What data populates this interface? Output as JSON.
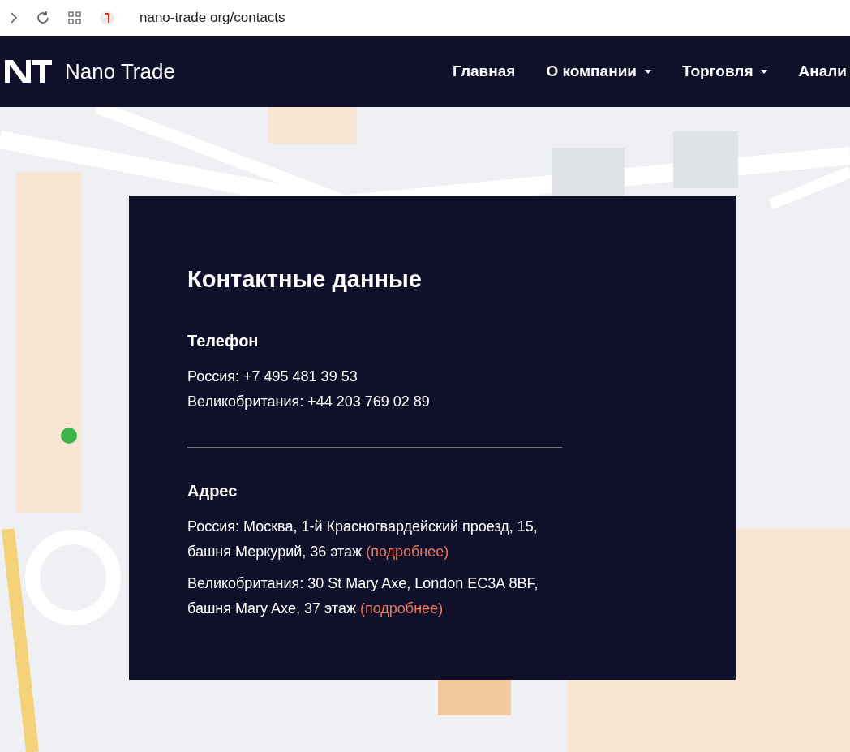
{
  "browser": {
    "url": "nano-trade org/contacts"
  },
  "navbar": {
    "brand": "Nano Trade",
    "items": [
      {
        "label": "Главная",
        "dropdown": false
      },
      {
        "label": "О компании",
        "dropdown": true
      },
      {
        "label": "Торговля",
        "dropdown": true
      },
      {
        "label": "Анали",
        "dropdown": false
      }
    ]
  },
  "contacts": {
    "title": "Контактные данные",
    "phone": {
      "heading": "Телефон",
      "lines": [
        "Россия: +7 495 481 39 53",
        "Великобритания: +44 203 769 02 89"
      ]
    },
    "address": {
      "heading": "Адрес",
      "entries": [
        {
          "lines": [
            "Россия: Москва, 1-й Красногвардейский проезд, 15,",
            "башня Меркурий, 36 этаж"
          ],
          "link": "(подробнее)"
        },
        {
          "lines": [
            "Великобритания: 30 St Mary Axe, London EC3A 8BF,",
            "башня Mary Axe, 37 этаж"
          ],
          "link": "(подробнее)"
        }
      ]
    }
  }
}
